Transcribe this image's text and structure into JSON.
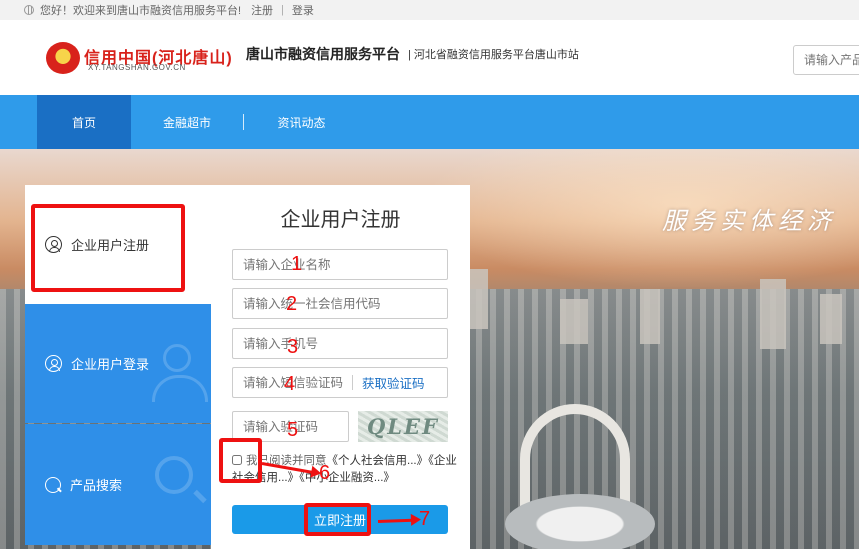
{
  "topbar": {
    "welcome": "您好！欢迎来到唐山市融资信用服务平台!",
    "register": "注册",
    "separator": "|",
    "login": "登录"
  },
  "header": {
    "logo_text": "信用中国(河北唐山)",
    "logo_domain": "XY.TANGSHAN.GOV.CN",
    "site_title": "唐山市融资信用服务平台",
    "site_subtitle": "| 河北省融资信用服务平台唐山市站",
    "search_placeholder": "请输入产品"
  },
  "nav": {
    "items": [
      {
        "label": "首页",
        "active": true
      },
      {
        "label": "金融超市",
        "active": false
      },
      {
        "label": "资讯动态",
        "active": false
      }
    ]
  },
  "banner": {
    "slogan": "服务实体经济"
  },
  "side": {
    "items": [
      {
        "label": "企业用户注册",
        "icon": "user-circle-icon",
        "active": true
      },
      {
        "label": "企业用户登录",
        "icon": "user-circle-icon",
        "active": false
      },
      {
        "label": "产品搜索",
        "icon": "search-icon",
        "active": false
      }
    ]
  },
  "form": {
    "title": "企业用户注册",
    "company_name_placeholder": "请输入企业名称",
    "credit_code_placeholder": "请输入统一社会信用代码",
    "phone_placeholder": "请输入手机号",
    "sms_code_placeholder": "请输入短信验证码",
    "get_sms_code": "获取验证码",
    "captcha_placeholder": "请输入验证码",
    "captcha_text": "QLEF",
    "agree_prefix": "我已阅读并同意",
    "agree_link1": "《个人社会信用...》",
    "agree_link2": "《企业社会信用...》",
    "agree_link3": "《中小企业融资...》",
    "submit": "立即注册"
  },
  "annotations": {
    "numbers": [
      "1",
      "2",
      "3",
      "4",
      "5",
      "6",
      "7"
    ],
    "color": "#ee1111"
  },
  "colors": {
    "nav_bg": "#2f9bea",
    "nav_active": "#1a6fc4",
    "side_blue": "#2f8fe8",
    "submit_blue": "#1a9ae8",
    "brand_red": "#d8221b"
  }
}
